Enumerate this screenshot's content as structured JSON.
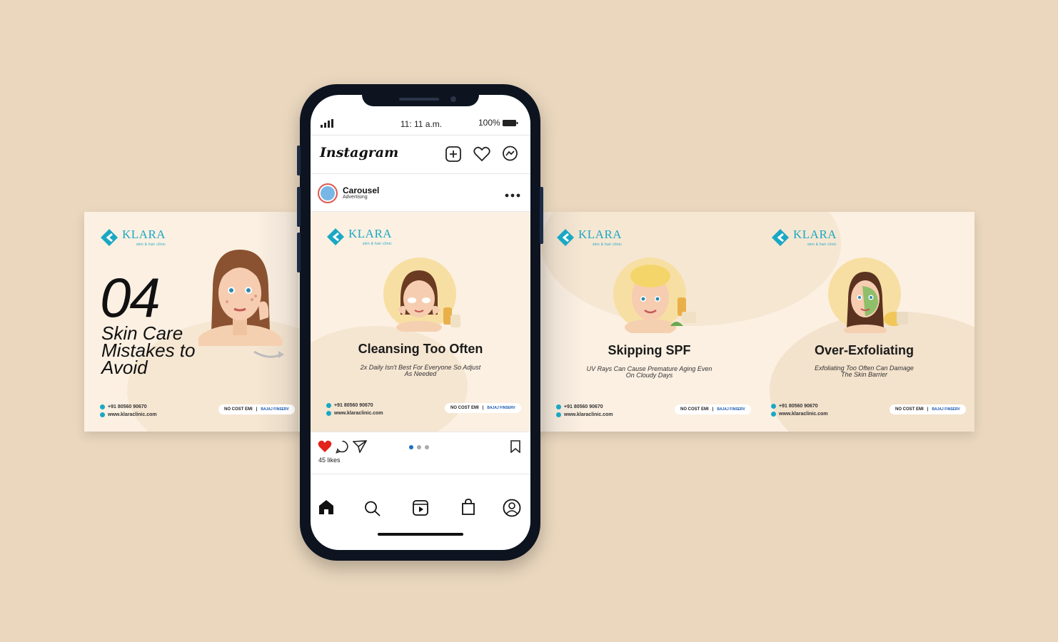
{
  "phone": {
    "status_time": "11: 11 a.m.",
    "battery": "100%",
    "app_name": "Instagram",
    "account_name": "Carousel",
    "account_sub": "Advertising",
    "likes": "45 likes"
  },
  "brand": {
    "name": "KLARA",
    "tagline": "skin & hair clinic",
    "phone": "+91 80560 90670",
    "website": "www.klaraclinic.com",
    "emi": "NO COST EMI",
    "partner": "BAJAJ FINSERV",
    "accent": "#1aa8c4"
  },
  "slides": {
    "cover": {
      "number": "04",
      "title_l1": "Skin Care",
      "title_l2": "Mistakes to",
      "title_l3": "Avoid"
    },
    "s1": {
      "title": "Cleansing Too Often",
      "sub_l1": "2x Daily Isn't Best For Everyone So Adjust",
      "sub_l2": "As Needed"
    },
    "s2": {
      "title": "Skipping SPF",
      "sub_l1": "UV Rays Can Cause Premature Aging Even",
      "sub_l2": "On Cloudy Days"
    },
    "s3": {
      "title": "Over-Exfoliating",
      "sub_l1": "Exfoliating Too Often Can Damage",
      "sub_l2": "The Skin Barrier"
    }
  },
  "icons": {
    "signal": "signal-icon",
    "battery": "battery-icon",
    "new_post": "plus-square-icon",
    "activity": "heart-icon",
    "messenger": "messenger-icon",
    "more": "more-icon",
    "like": "heart-filled-icon",
    "comment": "comment-icon",
    "share": "send-icon",
    "save": "bookmark-icon",
    "home": "home-icon",
    "search": "search-icon",
    "reels": "reels-icon",
    "shop": "shop-icon",
    "profile": "profile-icon"
  }
}
